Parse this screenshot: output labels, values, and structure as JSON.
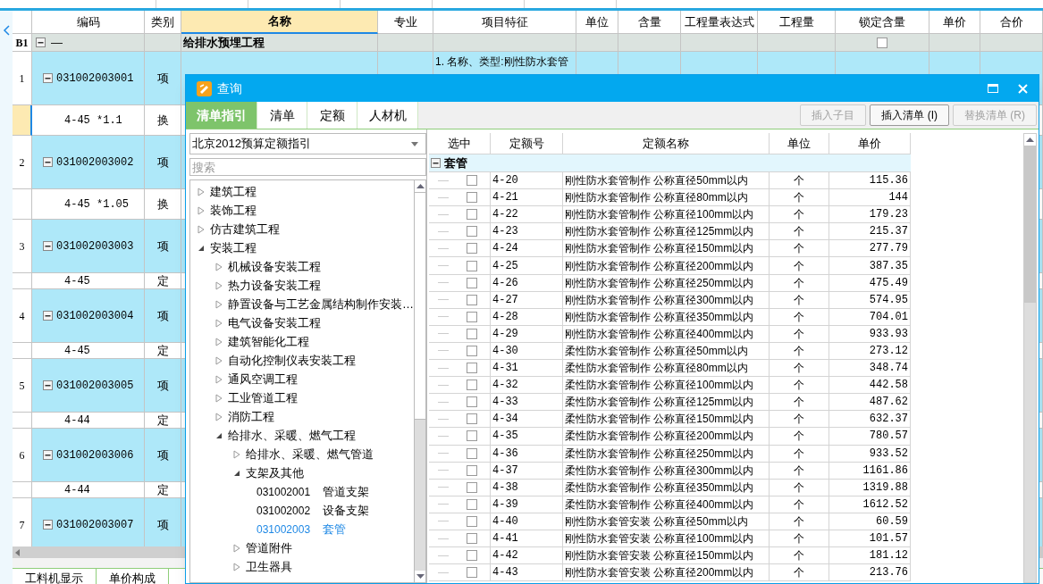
{
  "main_table": {
    "columns": [
      {
        "label": "编码",
        "selected": false
      },
      {
        "label": "类别",
        "selected": false
      },
      {
        "label": "名称",
        "selected": true
      },
      {
        "label": "专业",
        "selected": false
      },
      {
        "label": "项目特征",
        "selected": false
      },
      {
        "label": "单位",
        "selected": false
      },
      {
        "label": "含量",
        "selected": false
      },
      {
        "label": "工程量表达式",
        "selected": false
      },
      {
        "label": "工程量",
        "selected": false
      },
      {
        "label": "锁定含量",
        "selected": false
      },
      {
        "label": "单价",
        "selected": false
      },
      {
        "label": "合价",
        "selected": false
      }
    ],
    "group_row": {
      "number": "B1",
      "code": "—",
      "name": "给排水预埋工程",
      "locked": false
    },
    "rows": [
      {
        "kind": "item",
        "number": "1",
        "code": "031002003001",
        "type": "项",
        "feature": "1. 名称、类型:刚性防水套管",
        "selected": false
      },
      {
        "kind": "swap",
        "code": "4-45 *1.1",
        "type": "换",
        "selected": true
      },
      {
        "kind": "item",
        "number": "2",
        "code": "031002003002",
        "type": "项",
        "selected": false
      },
      {
        "kind": "swap",
        "code": "4-45 *1.05",
        "type": "换",
        "selected": false
      },
      {
        "kind": "item",
        "number": "3",
        "code": "031002003003",
        "type": "项",
        "selected": false
      },
      {
        "kind": "quota",
        "code": "4-45",
        "type": "定",
        "selected": false
      },
      {
        "kind": "item",
        "number": "4",
        "code": "031002003004",
        "type": "项",
        "selected": false
      },
      {
        "kind": "quota",
        "code": "4-45",
        "type": "定",
        "selected": false
      },
      {
        "kind": "item",
        "number": "5",
        "code": "031002003005",
        "type": "项",
        "selected": false
      },
      {
        "kind": "quota",
        "code": "4-44",
        "type": "定",
        "selected": false
      },
      {
        "kind": "item",
        "number": "6",
        "code": "031002003006",
        "type": "项",
        "selected": false
      },
      {
        "kind": "quota",
        "code": "4-44",
        "type": "定",
        "selected": false
      },
      {
        "kind": "item",
        "number": "7",
        "code": "031002003007",
        "type": "项",
        "selected": false
      }
    ]
  },
  "bottom_tabs": [
    "工料机显示",
    "单价构成"
  ],
  "dialog": {
    "title": "查询",
    "tabs": [
      {
        "label": "清单指引",
        "selected": true
      },
      {
        "label": "清单",
        "selected": false
      },
      {
        "label": "定额",
        "selected": false
      },
      {
        "label": "人材机",
        "selected": false
      }
    ],
    "buttons": [
      {
        "label": "插入子目",
        "disabled": true
      },
      {
        "label": "插入清单 (I)",
        "disabled": false
      },
      {
        "label": "替换清单 (R)",
        "disabled": true
      }
    ],
    "library": "北京2012预算定额指引",
    "search": {
      "placeholder": "搜索"
    },
    "tree": [
      {
        "label": "建筑工程",
        "expanded": false
      },
      {
        "label": "装饰工程",
        "expanded": false
      },
      {
        "label": "仿古建筑工程",
        "expanded": false
      },
      {
        "label": "安装工程",
        "expanded": true,
        "children": [
          {
            "label": "机械设备安装工程",
            "expanded": false
          },
          {
            "label": "热力设备安装工程",
            "expanded": false
          },
          {
            "label": "静置设备与工艺金属结构制作安装…",
            "expanded": false
          },
          {
            "label": "电气设备安装工程",
            "expanded": false
          },
          {
            "label": "建筑智能化工程",
            "expanded": false
          },
          {
            "label": "自动化控制仪表安装工程",
            "expanded": false
          },
          {
            "label": "通风空调工程",
            "expanded": false
          },
          {
            "label": "工业管道工程",
            "expanded": false
          },
          {
            "label": "消防工程",
            "expanded": false
          },
          {
            "label": "给排水、采暖、燃气工程",
            "expanded": true,
            "children": [
              {
                "label": "给排水、采暖、燃气管道",
                "expanded": false
              },
              {
                "label": "支架及其他",
                "expanded": true,
                "children": [
                  {
                    "kind": "leaf",
                    "code": "031002001",
                    "label": "管道支架",
                    "selected": false
                  },
                  {
                    "kind": "leaf",
                    "code": "031002002",
                    "label": "设备支架",
                    "selected": false
                  },
                  {
                    "kind": "leaf",
                    "code": "031002003",
                    "label": "套管",
                    "selected": true
                  }
                ]
              },
              {
                "label": "管道附件",
                "expanded": false
              },
              {
                "label": "卫生器具",
                "expanded": false
              }
            ]
          }
        ]
      }
    ],
    "grid": {
      "columns": [
        "选中",
        "定额号",
        "定额名称",
        "单位",
        "单价"
      ],
      "group": {
        "label": "套管",
        "expanded": true
      },
      "rows": [
        {
          "code": "4-20",
          "name": "刚性防水套管制作 公称直径50mm以内",
          "unit": "个",
          "price": "115.36",
          "checked": false
        },
        {
          "code": "4-21",
          "name": "刚性防水套管制作 公称直径80mm以内",
          "unit": "个",
          "price": "144",
          "checked": false
        },
        {
          "code": "4-22",
          "name": "刚性防水套管制作 公称直径100mm以内",
          "unit": "个",
          "price": "179.23",
          "checked": false
        },
        {
          "code": "4-23",
          "name": "刚性防水套管制作 公称直径125mm以内",
          "unit": "个",
          "price": "215.37",
          "checked": false
        },
        {
          "code": "4-24",
          "name": "刚性防水套管制作 公称直径150mm以内",
          "unit": "个",
          "price": "277.79",
          "checked": false
        },
        {
          "code": "4-25",
          "name": "刚性防水套管制作 公称直径200mm以内",
          "unit": "个",
          "price": "387.35",
          "checked": false
        },
        {
          "code": "4-26",
          "name": "刚性防水套管制作 公称直径250mm以内",
          "unit": "个",
          "price": "475.49",
          "checked": false
        },
        {
          "code": "4-27",
          "name": "刚性防水套管制作 公称直径300mm以内",
          "unit": "个",
          "price": "574.95",
          "checked": false
        },
        {
          "code": "4-28",
          "name": "刚性防水套管制作 公称直径350mm以内",
          "unit": "个",
          "price": "704.01",
          "checked": false
        },
        {
          "code": "4-29",
          "name": "刚性防水套管制作 公称直径400mm以内",
          "unit": "个",
          "price": "933.93",
          "checked": false
        },
        {
          "code": "4-30",
          "name": "柔性防水套管制作 公称直径50mm以内",
          "unit": "个",
          "price": "273.12",
          "checked": false
        },
        {
          "code": "4-31",
          "name": "柔性防水套管制作 公称直径80mm以内",
          "unit": "个",
          "price": "348.74",
          "checked": false
        },
        {
          "code": "4-32",
          "name": "柔性防水套管制作 公称直径100mm以内",
          "unit": "个",
          "price": "442.58",
          "checked": false
        },
        {
          "code": "4-33",
          "name": "柔性防水套管制作 公称直径125mm以内",
          "unit": "个",
          "price": "487.62",
          "checked": false
        },
        {
          "code": "4-34",
          "name": "柔性防水套管制作 公称直径150mm以内",
          "unit": "个",
          "price": "632.37",
          "checked": false
        },
        {
          "code": "4-35",
          "name": "柔性防水套管制作 公称直径200mm以内",
          "unit": "个",
          "price": "780.57",
          "checked": false
        },
        {
          "code": "4-36",
          "name": "柔性防水套管制作 公称直径250mm以内",
          "unit": "个",
          "price": "933.52",
          "checked": false
        },
        {
          "code": "4-37",
          "name": "柔性防水套管制作 公称直径300mm以内",
          "unit": "个",
          "price": "1161.86",
          "checked": false
        },
        {
          "code": "4-38",
          "name": "柔性防水套管制作 公称直径350mm以内",
          "unit": "个",
          "price": "1319.88",
          "checked": false
        },
        {
          "code": "4-39",
          "name": "柔性防水套管制作 公称直径400mm以内",
          "unit": "个",
          "price": "1612.52",
          "checked": false
        },
        {
          "code": "4-40",
          "name": "刚性防水套管安装 公称直径50mm以内",
          "unit": "个",
          "price": "60.59",
          "checked": false
        },
        {
          "code": "4-41",
          "name": "刚性防水套管安装 公称直径100mm以内",
          "unit": "个",
          "price": "101.57",
          "checked": false
        },
        {
          "code": "4-42",
          "name": "刚性防水套管安装 公称直径150mm以内",
          "unit": "个",
          "price": "181.12",
          "checked": false
        },
        {
          "code": "4-43",
          "name": "刚性防水套管安装 公称直径200mm以内",
          "unit": "个",
          "price": "213.76",
          "checked": false
        }
      ]
    }
  }
}
